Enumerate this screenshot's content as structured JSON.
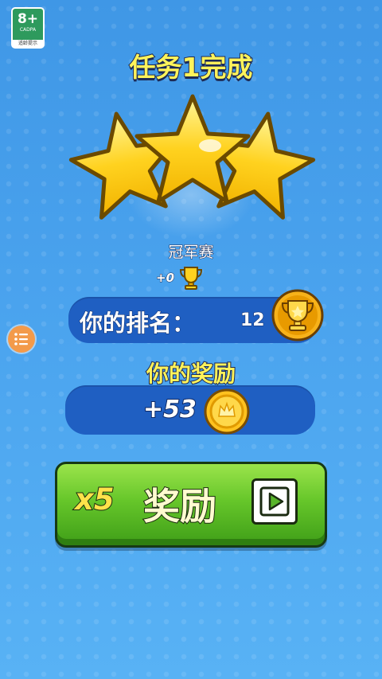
{
  "age_rating": {
    "age": "8+",
    "org": "CADPA",
    "tip": "适龄提示"
  },
  "title": "任务1完成",
  "stars_earned": 3,
  "stars_total": 3,
  "mode": {
    "name": "冠军赛",
    "trophy_delta": "+0"
  },
  "rank": {
    "label": "你的排名：",
    "value": "12"
  },
  "reward": {
    "heading": "你的奖励",
    "coins": "+53"
  },
  "claim_button": {
    "multiplier": "x5",
    "label": "奖励"
  },
  "icons": {
    "trophy": "trophy-icon",
    "medal": "trophy-medal-icon",
    "coin": "coin-icon",
    "play": "play-video-icon",
    "menu": "menu-list-icon"
  },
  "colors": {
    "title_yellow": "#fff35a",
    "button_green": "#66c62a",
    "pill_blue": "#1f5fc2"
  }
}
